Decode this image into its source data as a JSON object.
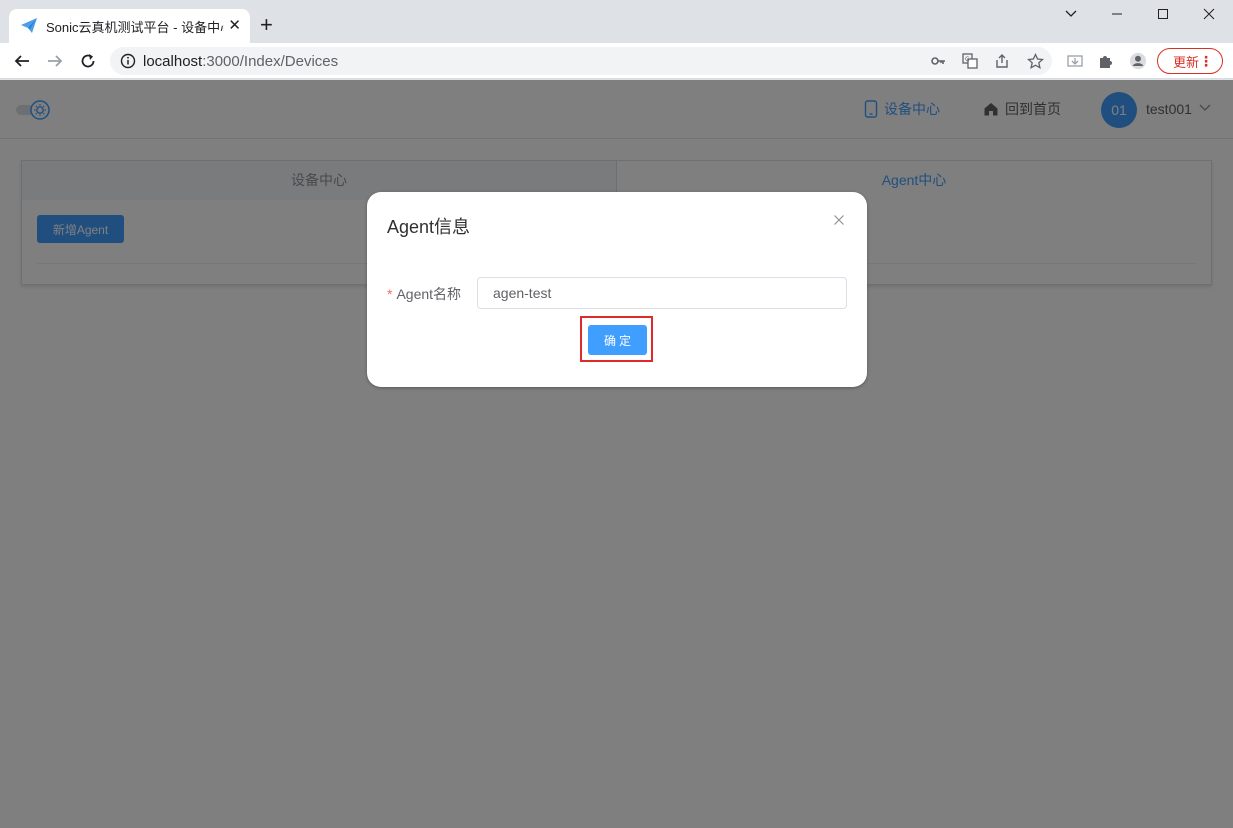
{
  "browser": {
    "tab_title": "Sonic云真机测试平台 - 设备中心",
    "tab_close": "✕",
    "new_tab": "+",
    "url_host": "localhost",
    "url_rest": ":3000/Index/Devices",
    "update_label": "更新",
    "update_menu": "⋮",
    "win_min": "—",
    "win_max": "☐",
    "win_close": "✕",
    "win_tabsearch": "⌄"
  },
  "header": {
    "nav_device": "设备中心",
    "nav_home": "回到首页",
    "avatar_text": "01",
    "username": "test001"
  },
  "card": {
    "tab_devices": "设备中心",
    "tab_agents": "Agent中心",
    "add_agent": "新增Agent"
  },
  "dialog": {
    "title": "Agent信息",
    "required_mark": "*",
    "name_label": "Agent名称",
    "name_value": "agen-test",
    "confirm": "确定"
  },
  "colors": {
    "primary": "#409eff",
    "highlight": "#e02a2a",
    "required": "#f56c6c"
  }
}
